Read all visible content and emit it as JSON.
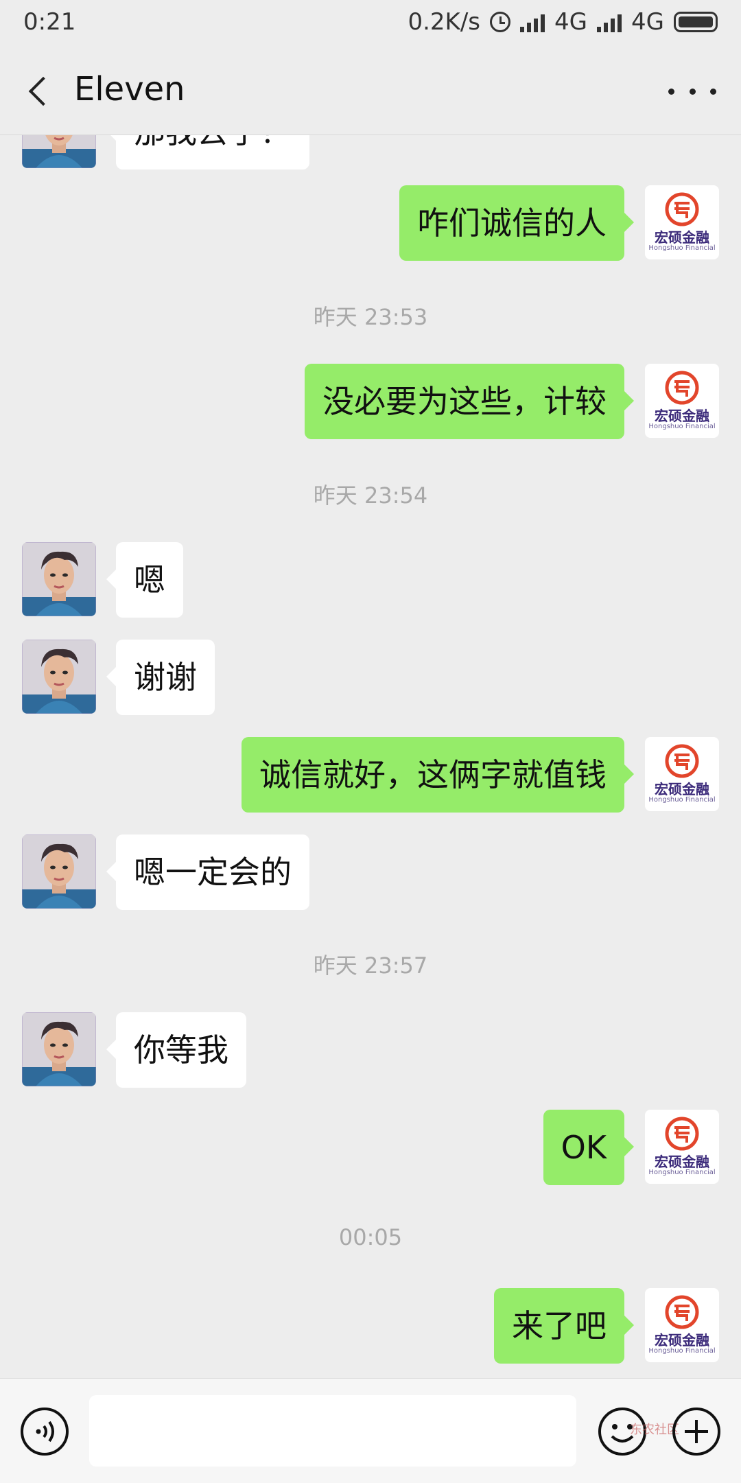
{
  "status_bar": {
    "time": "0:21",
    "net_speed": "0.2K/s",
    "signal1_label": "4G",
    "signal2_label": "4G"
  },
  "header": {
    "title": "Eleven",
    "back_icon": "chevron-left-icon",
    "more_icon": "more-dots-icon"
  },
  "brand_avatar": {
    "name": "宏硕金融",
    "subtitle": "Hongshuo Financial"
  },
  "messages": {
    "m0": "那我去了？",
    "m1": "咋们诚信的人",
    "t1": "昨天 23:53",
    "m2": "没必要为这些，计较",
    "t2": "昨天 23:54",
    "m3": "嗯",
    "m4": "谢谢",
    "m5": "诚信就好，这俩字就值钱",
    "m6": "嗯一定会的",
    "t3": "昨天 23:57",
    "m7": "你等我",
    "m8": "OK",
    "t4": "00:05",
    "m9": "来了吧"
  },
  "input_bar": {
    "text_value": "",
    "watermark": "东农社区"
  },
  "colors": {
    "background": "#ededed",
    "sent_bubble": "#95ec69",
    "received_bubble": "#ffffff",
    "brand_red": "#e2452b"
  }
}
